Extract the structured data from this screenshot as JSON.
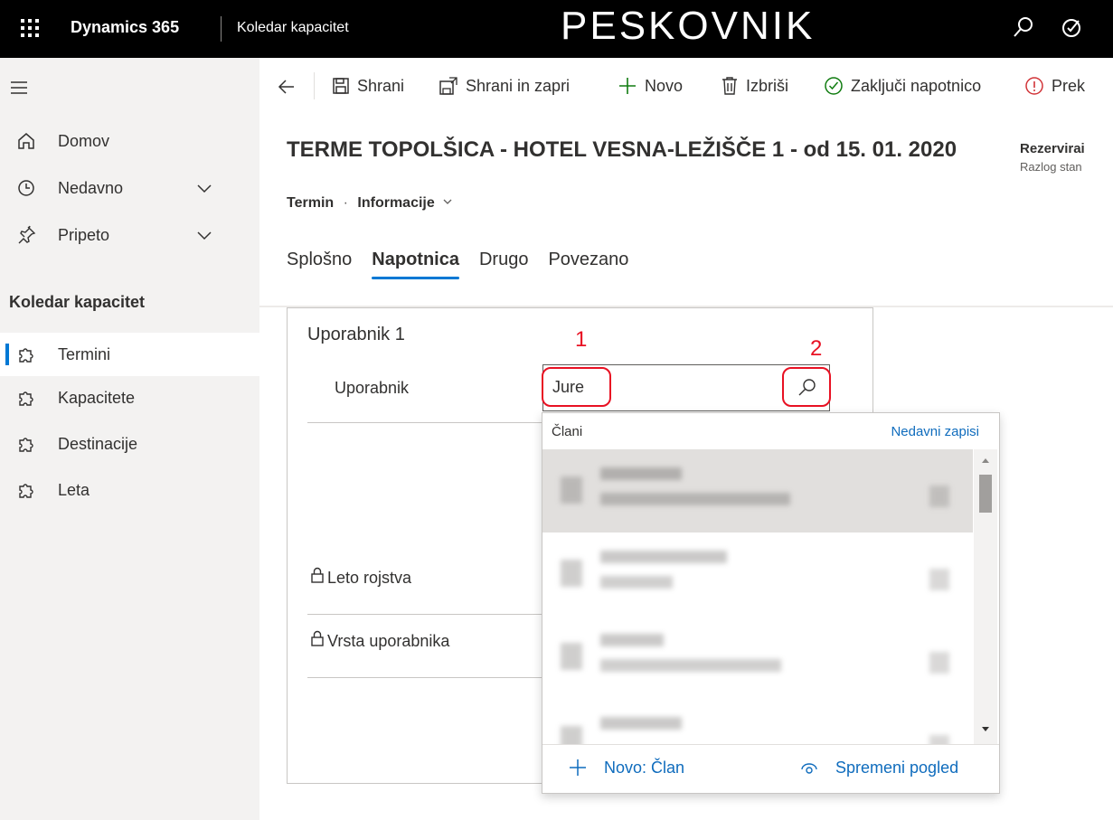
{
  "topbar": {
    "app_name": "Dynamics 365",
    "area_name": "Koledar kapacitet",
    "env_title": "PESKOVNIK"
  },
  "sidebar": {
    "items_top": [
      {
        "label": "Domov",
        "icon": "home-icon"
      },
      {
        "label": "Nedavno",
        "icon": "clock-icon"
      },
      {
        "label": "Pripeto",
        "icon": "pin-icon"
      }
    ],
    "section_title": "Koledar kapacitet",
    "entities": [
      {
        "label": "Termini",
        "icon": "puzzle-icon",
        "selected": true
      },
      {
        "label": "Kapacitete",
        "icon": "puzzle-icon"
      },
      {
        "label": "Destinacije",
        "icon": "puzzle-icon"
      },
      {
        "label": "Leta",
        "icon": "puzzle-icon"
      }
    ]
  },
  "commandbar": {
    "save": "Shrani",
    "save_close": "Shrani in zapri",
    "new": "Novo",
    "delete": "Izbriši",
    "complete": "Zaključi napotnico",
    "more": "Prek"
  },
  "header": {
    "title": "TERME TOPOLŠICA - HOTEL VESNA-LEŽIŠČE 1 - od 15. 01. 2020",
    "entity": "Termin",
    "separator": "·",
    "form": "Informacije",
    "right_title": "Rezervirai",
    "right_sub": "Razlog stan",
    "tabs": [
      "Splošno",
      "Napotnica",
      "Drugo",
      "Povezano"
    ]
  },
  "form": {
    "section_title": "Uporabnik 1",
    "user_label": "Uporabnik",
    "user_value": "Jure",
    "birth_year_label": "Leto rojstva",
    "user_type_label": "Vrsta uporabnika"
  },
  "annotations": {
    "marker1": "1",
    "marker2": "2"
  },
  "dropdown": {
    "left_header": "Člani",
    "right_header": "Nedavni zapisi",
    "new_label": "Novo: Član",
    "change_view_label": "Spremeni pogled"
  },
  "colors": {
    "accent": "#0078d4",
    "highlight": "#e81123"
  }
}
